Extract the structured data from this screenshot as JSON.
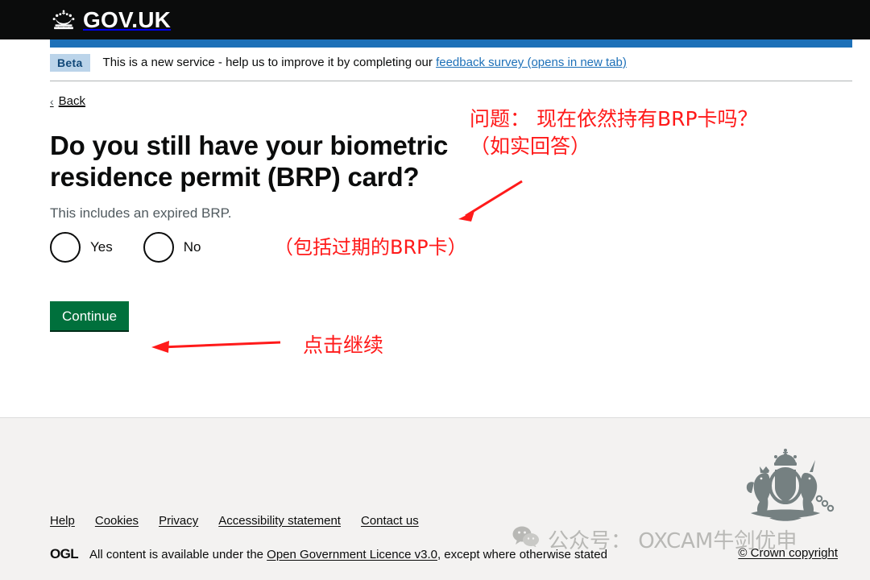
{
  "header": {
    "logo_text": "GOV.UK",
    "crown_icon": "crown-icon"
  },
  "phase_banner": {
    "tag": "Beta",
    "text_before": "This is a new service - help us to improve it by completing our ",
    "link": "feedback survey (opens in new tab)"
  },
  "back": {
    "chevron": "‹",
    "label": "Back"
  },
  "main": {
    "question": "Do you still have your biometric residence permit (BRP) card?",
    "hint": "This includes an expired BRP.",
    "radios": [
      {
        "label": "Yes",
        "selected": false
      },
      {
        "label": "No",
        "selected": false
      }
    ],
    "continue_label": "Continue"
  },
  "annotations": [
    {
      "id": "question",
      "line1": "问题： 现在依然持有BRP卡吗？",
      "line2": "（如实回答）"
    },
    {
      "id": "include",
      "line1": "（包括过期的BRP卡）"
    },
    {
      "id": "continue",
      "line1": "点击继续"
    }
  ],
  "footer": {
    "links": [
      "Help",
      "Cookies",
      "Privacy",
      "Accessibility statement",
      "Contact us"
    ],
    "ogl_logo": "OGL",
    "licence_before": "All content is available under the ",
    "licence_link": "Open Government Licence v3.0",
    "licence_after": ", except where otherwise stated",
    "crown_copyright": "© Crown copyright"
  },
  "watermark": {
    "text": "公众号： OXCAM牛剑优申"
  },
  "colors": {
    "header_bg": "#0b0c0c",
    "blue_bar": "#1d70b8",
    "beta_bg": "#bbd4ea",
    "green_button": "#00703c",
    "footer_bg": "#f3f2f1",
    "annotation_red": "#ff1a1a",
    "link_blue": "#1d70b8",
    "hint_grey": "#505a5f"
  }
}
